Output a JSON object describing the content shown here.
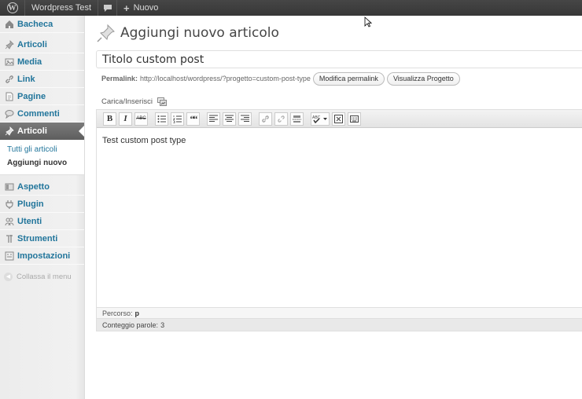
{
  "adminbar": {
    "site_name": "Wordpress Test",
    "new_label": "Nuovo"
  },
  "sidebar": {
    "items_top": [
      {
        "label": "Bacheca",
        "icon": "dashboard-icon"
      }
    ],
    "items_content": [
      {
        "label": "Articoli",
        "icon": "pin-icon"
      },
      {
        "label": "Media",
        "icon": "media-icon"
      },
      {
        "label": "Link",
        "icon": "link-icon"
      },
      {
        "label": "Pagine",
        "icon": "page-icon"
      },
      {
        "label": "Commenti",
        "icon": "comment-icon"
      }
    ],
    "active": {
      "label": "Articoli",
      "icon": "pin-icon"
    },
    "submenu": [
      {
        "label": "Tutti gli articoli",
        "current": false
      },
      {
        "label": "Aggiungi nuovo",
        "current": true
      }
    ],
    "items_admin": [
      {
        "label": "Aspetto",
        "icon": "appearance-icon"
      },
      {
        "label": "Plugin",
        "icon": "plugin-icon"
      },
      {
        "label": "Utenti",
        "icon": "users-icon"
      },
      {
        "label": "Strumenti",
        "icon": "tools-icon"
      },
      {
        "label": "Impostazioni",
        "icon": "settings-icon"
      }
    ],
    "collapse_label": "Collassa il menu"
  },
  "main": {
    "page_title": "Aggiungi nuovo articolo",
    "title_value": "Titolo custom post",
    "permalink_label": "Permalink:",
    "permalink_url": "http://localhost/wordpress/?progetto=custom-post-type",
    "edit_permalink_label": "Modifica permalink",
    "view_label": "Visualizza Progetto",
    "upload_label": "Carica/Inserisci",
    "editor_content": "Test custom post type",
    "path_label": "Percorso:",
    "path_value": "p",
    "wordcount_label": "Conteggio parole:",
    "wordcount_value": "3"
  },
  "toolbar": {
    "bold": "B",
    "italic": "I",
    "strike": "ABC",
    "quote": "““",
    "spell": "ABC"
  }
}
